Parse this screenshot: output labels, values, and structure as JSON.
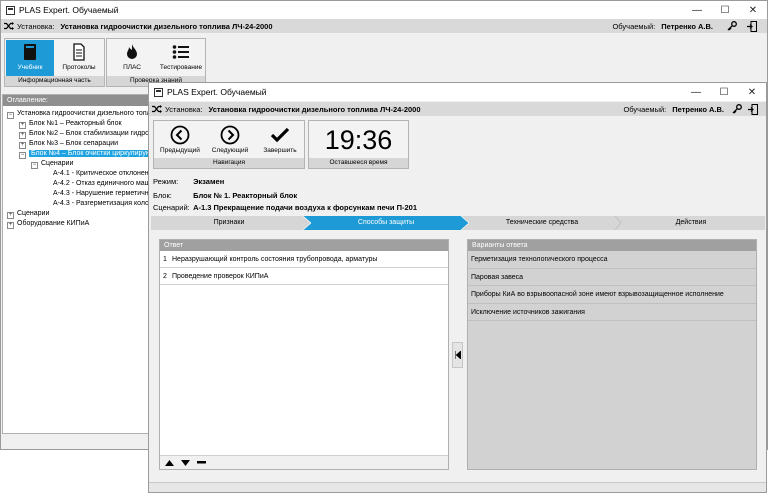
{
  "back_window": {
    "title": "PLAS Expert. Обучаемый",
    "install_label": "Установка:",
    "install_value": "Установка гидроочистки дизельного топлива ЛЧ-24-2000",
    "trainee_label": "Обучаемый:",
    "trainee_value": "Петренко А.В.",
    "ribbon": {
      "info_group": {
        "label": "Информационная часть",
        "buttons": [
          "Учебник",
          "Протоколы"
        ]
      },
      "check_group": {
        "label": "Проверка знаний",
        "buttons": [
          "ПЛАС",
          "Тестирование"
        ]
      }
    },
    "contents_header": "Оглавление:",
    "tree": [
      "Установка гидроочистки дизельного топлива",
      "Блок №1 – Реакторный блок",
      "Блок №2 – Блок стабилизации гидрогенизата",
      "Блок №3 – Блок сепарации",
      "Блок №4 – Блок очистки циркулирующего ВСГ",
      "Сценарии",
      "А-4.1 - Критическое отклонение",
      "А-4.2 - Отказ единичного машинного",
      "А-4.3 - Нарушение герметичности",
      "А-4.3 - Разгерметизация колонны",
      "Сценарии",
      "Оборудование КИПиА"
    ]
  },
  "front_window": {
    "title": "PLAS Expert. Обучаемый",
    "install_label": "Установка:",
    "install_value": "Установка гидроочистки дизельного топлива ЛЧ-24-2000",
    "trainee_label": "Обучаемый:",
    "trainee_value": "Петренко А.В.",
    "nav": {
      "prev": "Предыдущий",
      "next": "Следующий",
      "finish": "Завершить",
      "group_label": "Навигация"
    },
    "timer": {
      "value": "19:36",
      "label": "Оставшееся время"
    },
    "mode_label": "Режим:",
    "mode_value": "Экзамен",
    "block_label": "Блок:",
    "block_value": "Блок № 1. Реакторный блок",
    "scenario_label": "Сценарий:",
    "scenario_value": "А-1.3 Прекращение подачи воздуха к форсункам печи П-201",
    "steps": [
      "Признаки",
      "Способы защиты",
      "Технические средства",
      "Действия"
    ],
    "active_step": 1,
    "answer_header": "Ответ",
    "answers": [
      {
        "num": "1",
        "text": "Неразрушающий контроль состояния трубопровода, арматуры"
      },
      {
        "num": "2",
        "text": "Проведение проверок КИПиА"
      }
    ],
    "variants_header": "Варианты ответа",
    "variants": [
      "Герметизация технологического процесса",
      "Паровая завеса",
      "Приборы КиА во взрывоопасной зоне имеют взрывозащищенное исполнение",
      "Исключение источников зажигания"
    ]
  },
  "colors": {
    "accent": "#1e9bd6",
    "selection": "#1fa3e0",
    "group_label_bg": "#d6d6d6"
  }
}
